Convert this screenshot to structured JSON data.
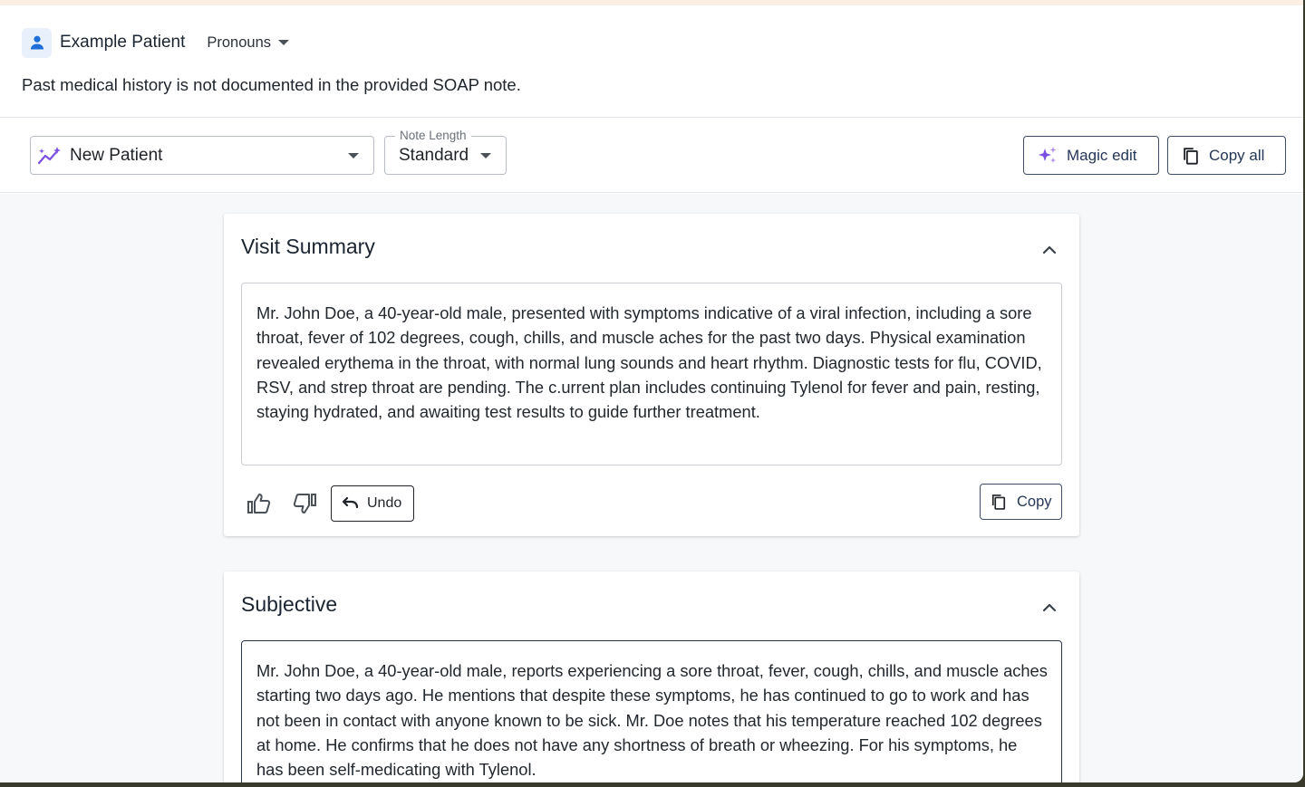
{
  "patient": {
    "name": "Example Patient",
    "pronouns_label": "Pronouns",
    "history_note": "Past medical history is not documented in the provided SOAP note."
  },
  "toolbar": {
    "template_value": "New Patient",
    "note_length_legend": "Note Length",
    "note_length_value": "Standard",
    "magic_edit_label": "Magic edit",
    "copy_all_label": "Copy all"
  },
  "sections": [
    {
      "title": "Visit Summary",
      "body": "Mr. John Doe, a 40-year-old male, presented with symptoms indicative of a viral infection, including a sore throat, fever of 102 degrees, cough, chills, and muscle aches for the past two days. Physical examination revealed erythema in the throat, with normal lung sounds and heart rhythm. Diagnostic tests for flu, COVID, RSV, and strep throat are pending. The c.urrent plan includes continuing Tylenol for fever and pain, resting, staying hydrated, and awaiting test results to guide further treatment.",
      "undo_label": "Undo",
      "copy_label": "Copy"
    },
    {
      "title": "Subjective",
      "body": "Mr. John Doe, a 40-year-old male, reports experiencing a sore throat, fever, cough, chills, and muscle aches starting two days ago. He mentions that despite these symptoms, he has continued to go to work and has not been in contact with anyone known to be sick. Mr. Doe notes that his temperature reached 102 degrees at home. He confirms that he does not have any shortness of breath or wheezing. For his symptoms, he has been self-medicating with Tylenol."
    }
  ],
  "colors": {
    "accent_purple": "#7b4fe0",
    "avatar_blue": "#1e6fd9",
    "button_outline": "#3f4d66",
    "content_background": "#f6f8fa"
  }
}
